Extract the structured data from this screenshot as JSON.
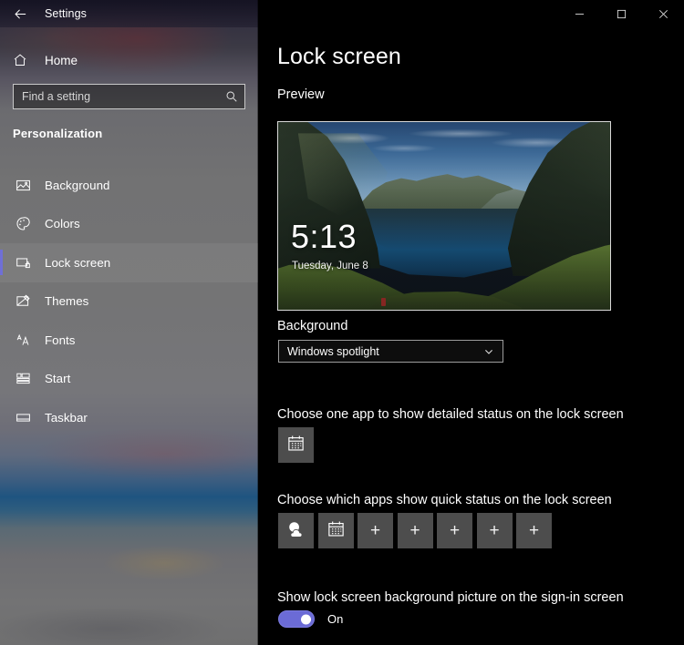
{
  "window": {
    "title": "Settings",
    "back_icon": "back-arrow-icon",
    "controls": {
      "minimize": "minimize-icon",
      "maximize": "maximize-icon",
      "close": "close-icon"
    }
  },
  "sidebar": {
    "home_label": "Home",
    "home_icon": "home-icon",
    "search": {
      "value": "",
      "placeholder": "Find a setting",
      "icon": "search-icon"
    },
    "category": "Personalization",
    "items": [
      {
        "label": "Background",
        "icon": "image-icon",
        "selected": false
      },
      {
        "label": "Colors",
        "icon": "palette-icon",
        "selected": false
      },
      {
        "label": "Lock screen",
        "icon": "lock-screen-icon",
        "selected": true
      },
      {
        "label": "Themes",
        "icon": "themes-icon",
        "selected": false
      },
      {
        "label": "Fonts",
        "icon": "fonts-icon",
        "selected": false
      },
      {
        "label": "Start",
        "icon": "start-icon",
        "selected": false
      },
      {
        "label": "Taskbar",
        "icon": "taskbar-icon",
        "selected": false
      }
    ]
  },
  "main": {
    "page_title": "Lock screen",
    "preview_heading": "Preview",
    "preview": {
      "clock": "5:13",
      "date": "Tuesday, June 8"
    },
    "background": {
      "label": "Background",
      "selected": "Windows spotlight",
      "chevron_icon": "chevron-down-icon"
    },
    "detailed_status": {
      "label": "Choose one app to show detailed status on the lock screen",
      "tiles": [
        {
          "icon": "calendar-icon"
        }
      ]
    },
    "quick_status": {
      "label": "Choose which apps show quick status on the lock screen",
      "tiles": [
        {
          "icon": "weather-icon"
        },
        {
          "icon": "calendar-icon"
        },
        {
          "icon": "plus-icon"
        },
        {
          "icon": "plus-icon"
        },
        {
          "icon": "plus-icon"
        },
        {
          "icon": "plus-icon"
        },
        {
          "icon": "plus-icon"
        }
      ]
    },
    "signin_picture": {
      "label": "Show lock screen background picture on the sign-in screen",
      "toggle_state": "On"
    }
  },
  "colors": {
    "accent": "#6b6bd6",
    "window_background": "#000000",
    "tile_background": "#4d4d4d",
    "text_primary": "#ffffff"
  }
}
